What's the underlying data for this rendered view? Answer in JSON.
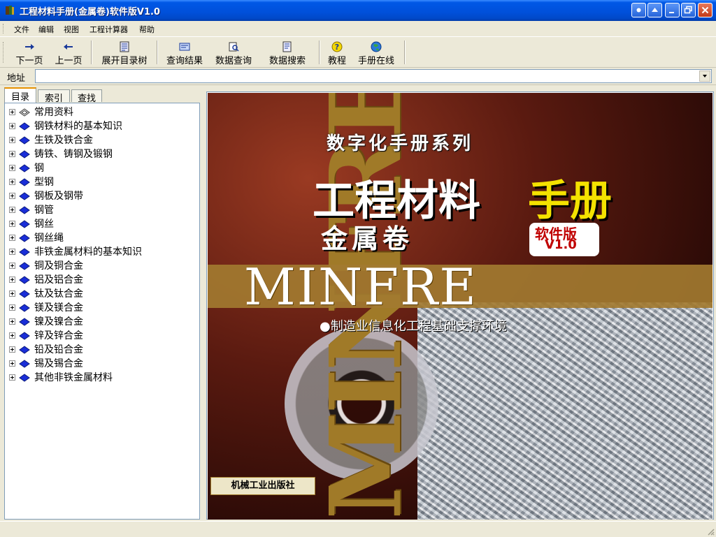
{
  "window": {
    "title": "工程材料手册(金属卷)软件版V1.0"
  },
  "menu": [
    "文件",
    "编辑",
    "视图",
    "工程计算器",
    "帮助"
  ],
  "toolbar": {
    "next": "下一页",
    "prev": "上一页",
    "expand": "展开目录树",
    "results": "查询结果",
    "query": "数据查询",
    "search": "数据搜索",
    "tutorial": "教程",
    "online": "手册在线"
  },
  "address": {
    "label": "地址",
    "value": ""
  },
  "tabs": [
    "目录",
    "索引",
    "查找"
  ],
  "tree": [
    "常用资料",
    "钢铁材料的基本知识",
    "生铁及铁合金",
    "铸铁、铸钢及锻钢",
    "钢",
    "型钢",
    "钢板及钢带",
    "钢管",
    "钢丝",
    "钢丝绳",
    "非铁金属材料的基本知识",
    "铜及铜合金",
    "铝及铝合金",
    "钛及钛合金",
    "镁及镁合金",
    "镍及镍合金",
    "锌及锌合金",
    "铅及铅合金",
    "锡及锡合金",
    "其他非铁金属材料"
  ],
  "cover": {
    "series": "数字化手册系列",
    "title_white": "工程材料",
    "title_yellow": "手册",
    "volume": "金属卷",
    "badge_line1": "软件版",
    "badge_line2": "V1.0",
    "brand": "MINFRE",
    "vertical_brand": "MINFRE",
    "slogan": "●制造业信息化工程基础支撑环境",
    "publisher": "机械工业出版社"
  },
  "colors": {
    "titlebar": "#0054E3",
    "cover_gold": "#A27A30",
    "cover_yellow": "#F4E200",
    "badge_red": "#C00000"
  }
}
